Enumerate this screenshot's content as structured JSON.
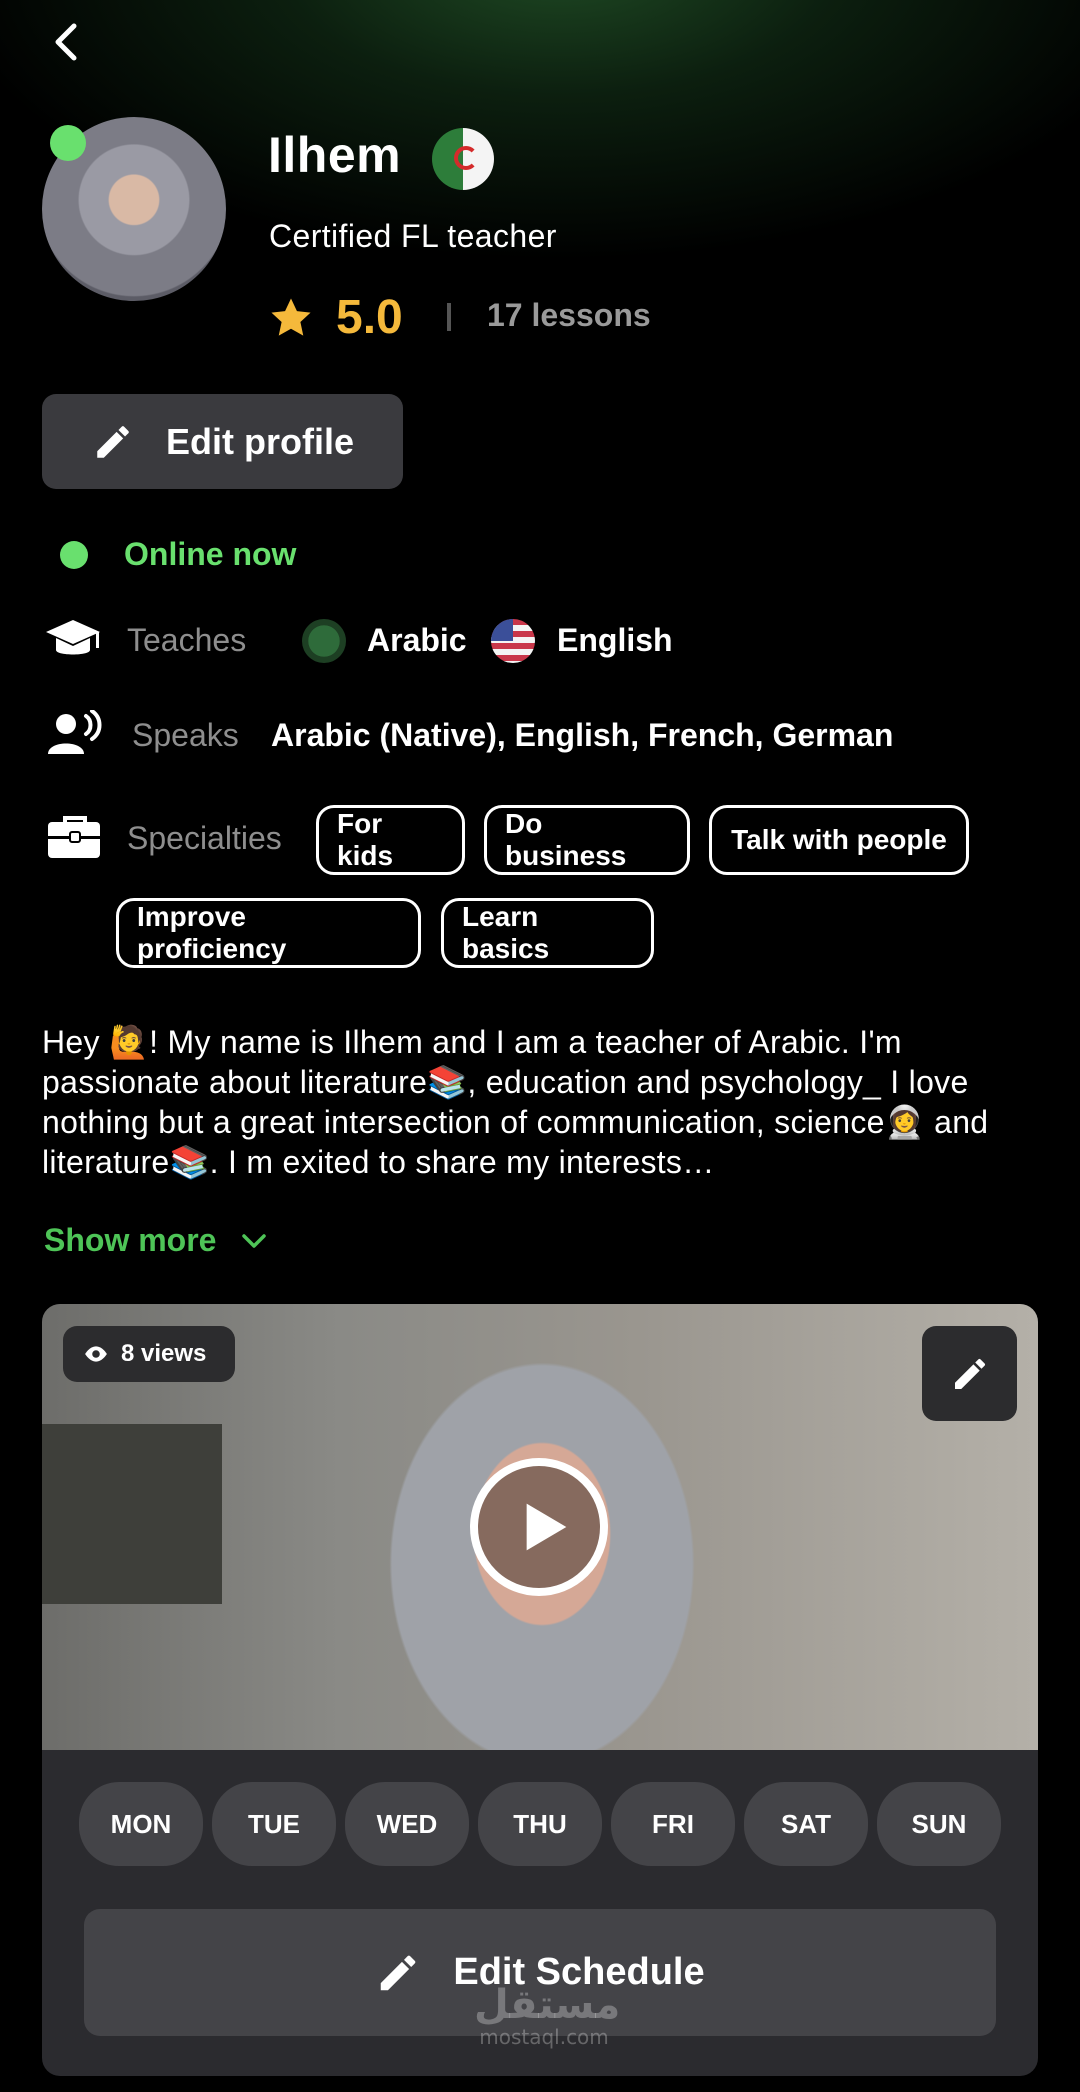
{
  "profile": {
    "name": "Ilhem",
    "title": "Certified FL teacher",
    "rating": "5.0",
    "lessons": "17 lessons",
    "edit_profile_label": "Edit profile",
    "online_status": "Online now"
  },
  "details": {
    "teaches_label": "Teaches",
    "teaches": [
      "Arabic",
      "English"
    ],
    "speaks_label": "Speaks",
    "speaks_value": "Arabic (Native), English, French, German",
    "specialties_label": "Specialties",
    "specialties": [
      "For kids",
      "Do business",
      "Talk with people",
      "Improve proficiency",
      "Learn basics"
    ]
  },
  "bio": {
    "text": "Hey 🙋! My name is Ilhem and I am a teacher of Arabic. I'm passionate about literature📚, education and psychology_ I love nothing but a great intersection of communication, science👩‍🚀 and literature📚. I m exited to share my interests…",
    "show_more_label": "Show more"
  },
  "video": {
    "views": "8 views"
  },
  "schedule": {
    "days": [
      "MON",
      "TUE",
      "WED",
      "THU",
      "FRI",
      "SAT",
      "SUN"
    ],
    "edit_label": "Edit Schedule"
  },
  "watermark": {
    "main": "مستقل",
    "sub": "mostaql.com"
  },
  "colors": {
    "accent_green": "#69e06e",
    "rating_gold": "#f5b93b",
    "button_gray": "#3a3a3e"
  }
}
